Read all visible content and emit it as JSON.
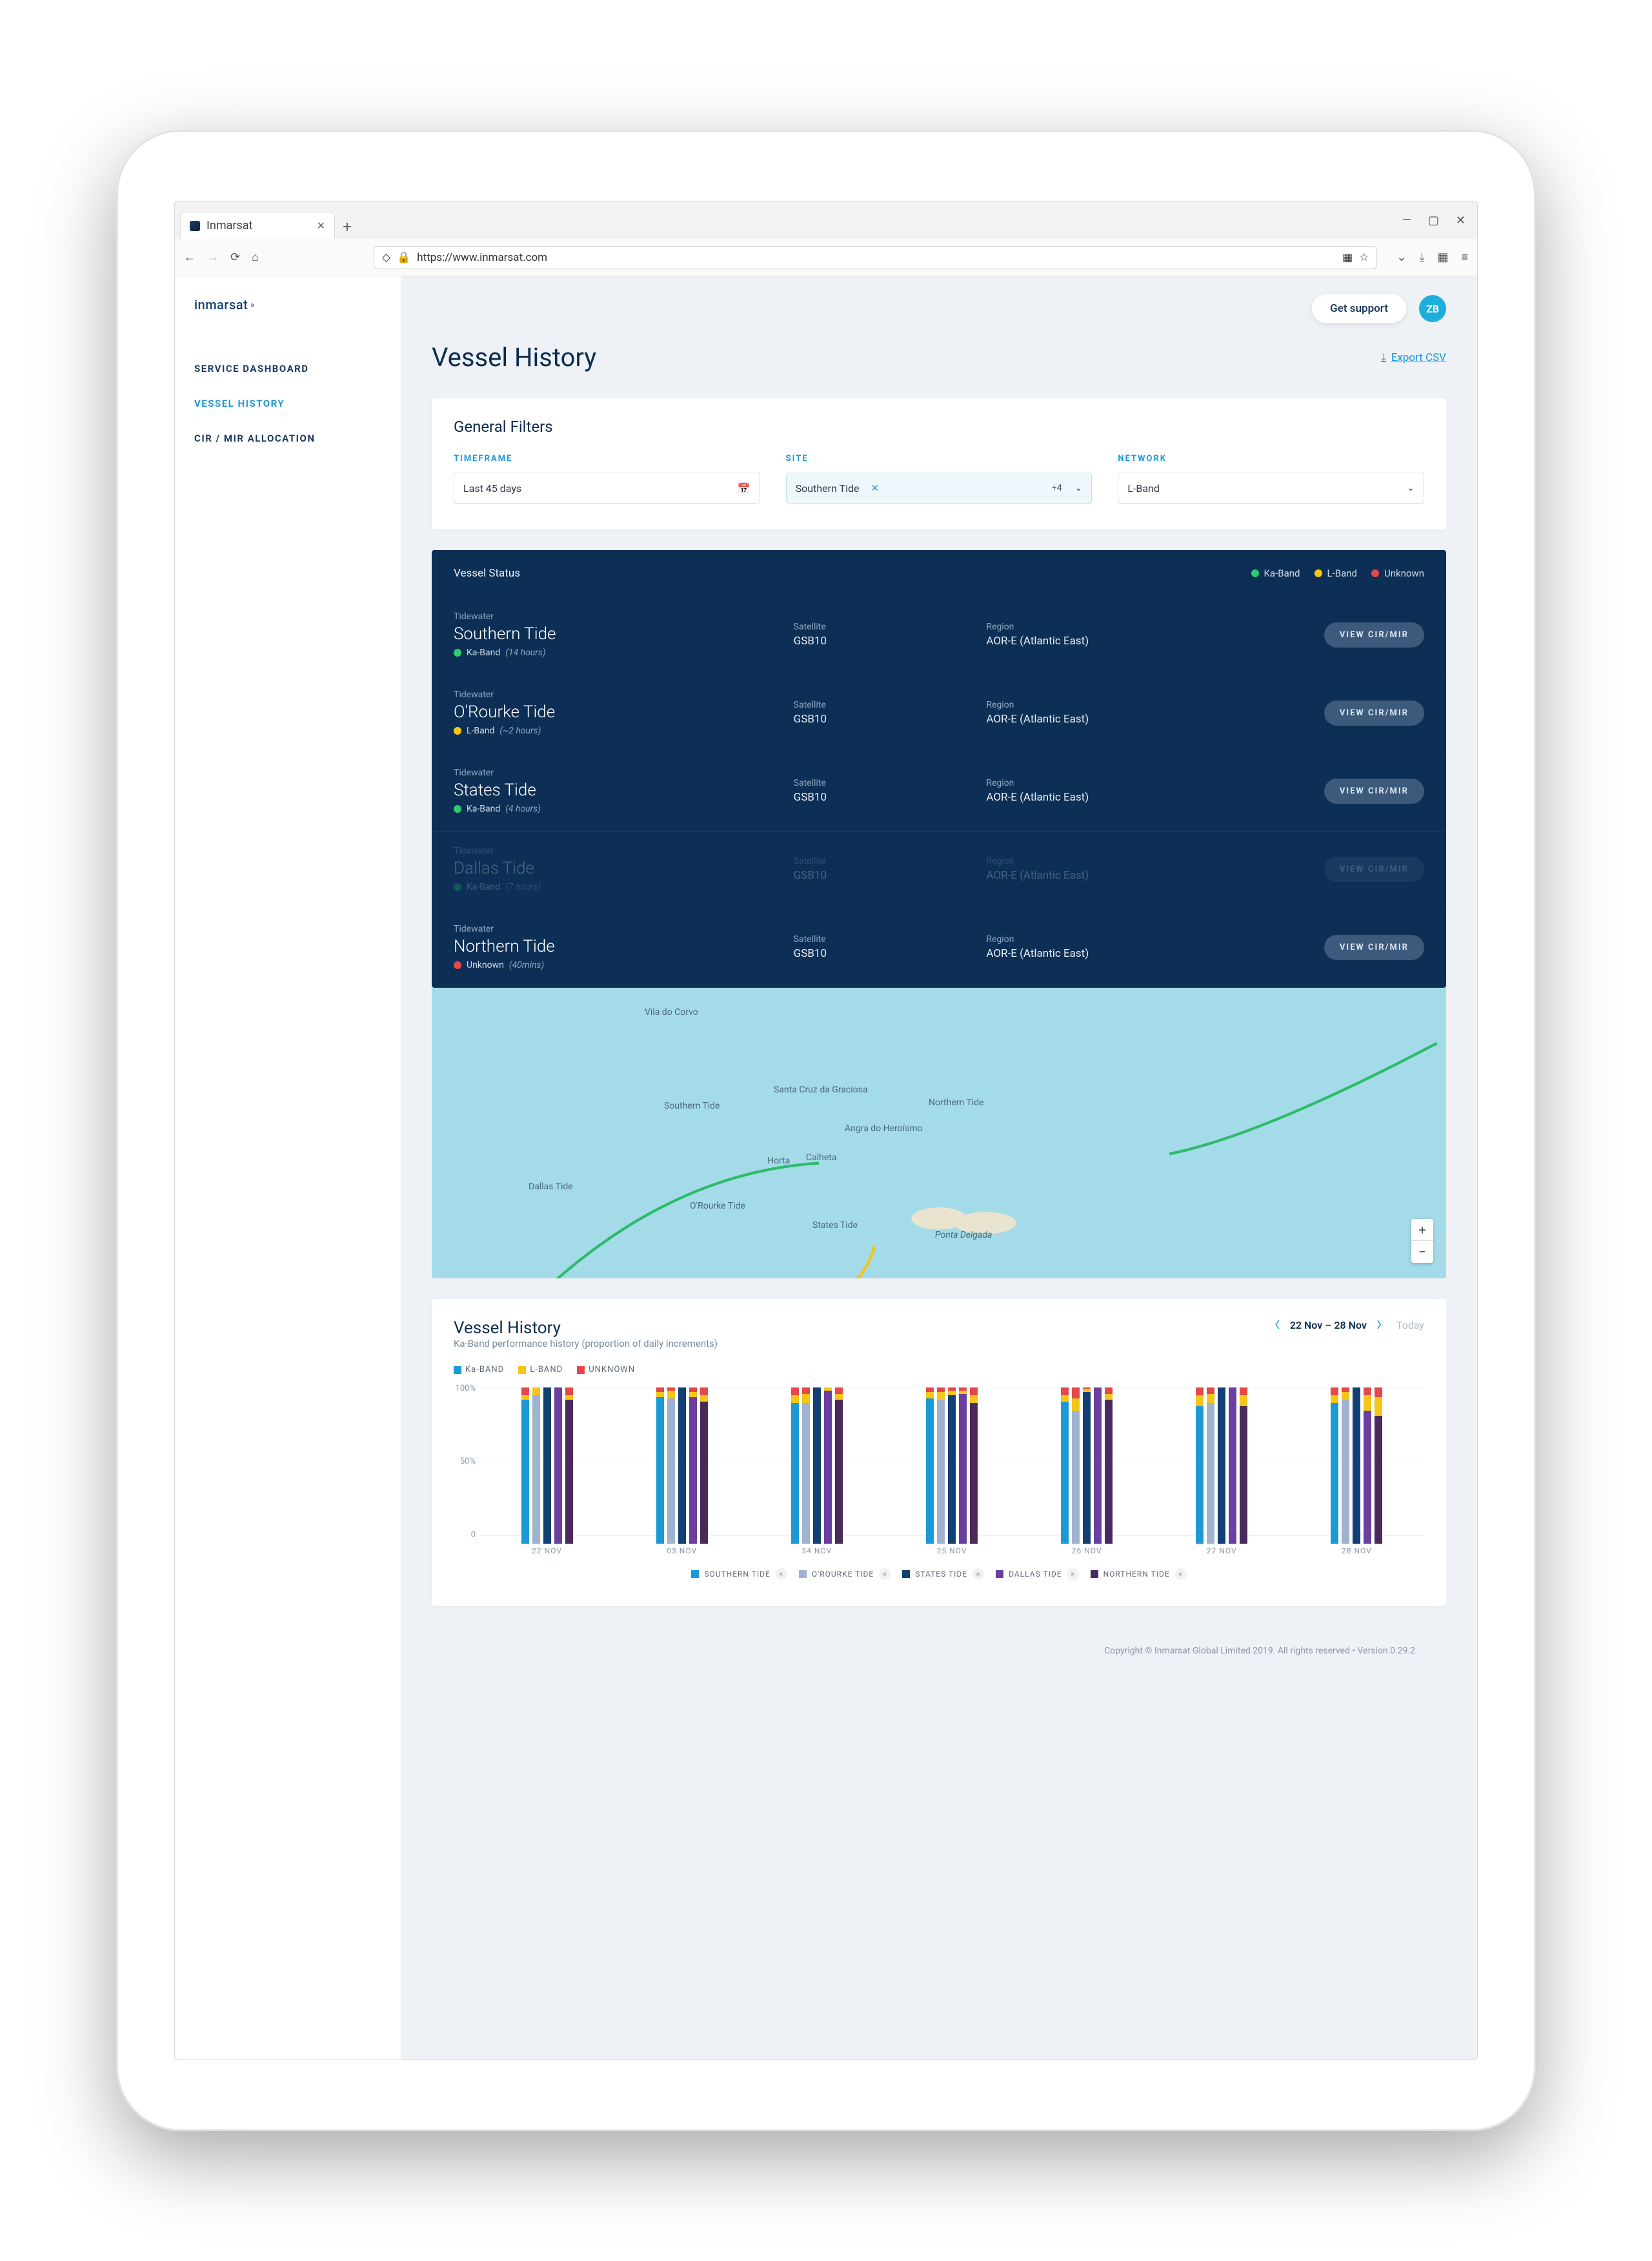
{
  "browser": {
    "tab_title": "Inmarsat",
    "url": "https://www.inmarsat.com"
  },
  "brand": "inmarsat",
  "header": {
    "support": "Get support",
    "avatar": "ZB"
  },
  "nav": {
    "dashboard": "SERVICE DASHBOARD",
    "history": "VESSEL HISTORY",
    "allocation": "CIR / MIR ALLOCATION"
  },
  "page": {
    "title": "Vessel History",
    "export": "Export CSV"
  },
  "filters": {
    "heading": "General Filters",
    "timeframe_label": "TIMEFRAME",
    "timeframe_value": "Last 45 days",
    "site_label": "SITE",
    "site_value": "Southern Tide",
    "site_count": "+4",
    "network_label": "NETWORK",
    "network_value": "L-Band"
  },
  "status": {
    "title": "Vessel Status",
    "legend": {
      "ka": "Ka-Band",
      "l": "L-Band",
      "un": "Unknown"
    },
    "cols": {
      "satellite": "Satellite",
      "region": "Region"
    },
    "button": "VIEW CIR/MIR",
    "vessels": [
      {
        "group": "Tidewater",
        "name": "Southern Tide",
        "band": "Ka-Band",
        "dot": "green",
        "time": "(14 hours)",
        "satellite": "GSB10",
        "region": "AOR-E (Atlantic East)",
        "faded": false
      },
      {
        "group": "Tidewater",
        "name": "O'Rourke Tide",
        "band": "L-Band",
        "dot": "yellow",
        "time": "(~2 hours)",
        "satellite": "GSB10",
        "region": "AOR-E (Atlantic East)",
        "faded": false
      },
      {
        "group": "Tidewater",
        "name": "States Tide",
        "band": "Ka-Band",
        "dot": "green",
        "time": "(4 hours)",
        "satellite": "GSB10",
        "region": "AOR-E (Atlantic East)",
        "faded": false
      },
      {
        "group": "Tidewater",
        "name": "Dallas Tide",
        "band": "Ka-Band",
        "dot": "green",
        "time": "(7 hours)",
        "satellite": "GSB10",
        "region": "AOR-E (Atlantic East)",
        "faded": true
      },
      {
        "group": "Tidewater",
        "name": "Northern Tide",
        "band": "Unknown",
        "dot": "red",
        "time": "(40mins)",
        "satellite": "GSB10",
        "region": "AOR-E (Atlantic East)",
        "faded": false
      }
    ]
  },
  "map": {
    "labels": {
      "vila": "Vila do Corvo",
      "santa": "Santa Cruz da Graciosa",
      "horta": "Horta",
      "calheta": "Calheta",
      "angra": "Angra do Heroísmo",
      "ponta": "Ponta Delgada"
    },
    "tracks": {
      "southern": "Southern Tide",
      "dallas": "Dallas Tide",
      "orourke": "O'Rourke Tide",
      "states": "States Tide",
      "northern": "Northern Tide"
    }
  },
  "chart": {
    "title": "Vessel History",
    "subtitle": "Ka-Band performance history (proportion of daily increments)",
    "range": "22 Nov – 28 Nov",
    "today": "Today",
    "legend": {
      "ka": "Ka-BAND",
      "l": "L-BAND",
      "un": "UNKNOWN"
    },
    "series_names": [
      "SOUTHERN TIDE",
      "O'ROURKE TIDE",
      "STATES TIDE",
      "DALLAS TIDE",
      "NORTHERN TIDE"
    ],
    "series_colors": [
      "#1c9ad6",
      "#9fb3d0",
      "#134074",
      "#6b3fa0",
      "#4a2a5a"
    ],
    "yticks": [
      "100%",
      "50%",
      "0"
    ],
    "categories": [
      "22 NOV",
      "03 NOV",
      "34 NOV",
      "25 NOV",
      "26 NOV",
      "27 NOV",
      "28 NOV"
    ]
  },
  "chart_data": {
    "type": "bar",
    "stacked": true,
    "ylim": [
      0,
      100
    ],
    "ylabel": "%",
    "categories": [
      "22 NOV",
      "03 NOV",
      "34 NOV",
      "25 NOV",
      "26 NOV",
      "27 NOV",
      "28 NOV"
    ],
    "series": [
      {
        "name": "SOUTHERN TIDE",
        "color": "#1c9ad6",
        "values": [
          {
            "ka": 92,
            "l": 3,
            "un": 5
          },
          {
            "ka": 94,
            "l": 3,
            "un": 3
          },
          {
            "ka": 90,
            "l": 5,
            "un": 5
          },
          {
            "ka": 93,
            "l": 4,
            "un": 3
          },
          {
            "ka": 91,
            "l": 4,
            "un": 5
          },
          {
            "ka": 88,
            "l": 7,
            "un": 5
          },
          {
            "ka": 90,
            "l": 5,
            "un": 5
          }
        ]
      },
      {
        "name": "O'ROURKE TIDE",
        "color": "#9fb3d0",
        "values": [
          {
            "ka": 95,
            "l": 5,
            "un": 0
          },
          {
            "ka": 93,
            "l": 5,
            "un": 2
          },
          {
            "ka": 90,
            "l": 6,
            "un": 4
          },
          {
            "ka": 92,
            "l": 5,
            "un": 3
          },
          {
            "ka": 85,
            "l": 8,
            "un": 7
          },
          {
            "ka": 90,
            "l": 6,
            "un": 4
          },
          {
            "ka": 92,
            "l": 5,
            "un": 3
          }
        ]
      },
      {
        "name": "STATES TIDE",
        "color": "#134074",
        "values": [
          {
            "ka": 100,
            "l": 0,
            "un": 0
          },
          {
            "ka": 100,
            "l": 0,
            "un": 0
          },
          {
            "ka": 100,
            "l": 0,
            "un": 0
          },
          {
            "ka": 95,
            "l": 3,
            "un": 2
          },
          {
            "ka": 97,
            "l": 2,
            "un": 1
          },
          {
            "ka": 100,
            "l": 0,
            "un": 0
          },
          {
            "ka": 100,
            "l": 0,
            "un": 0
          }
        ]
      },
      {
        "name": "DALLAS TIDE",
        "color": "#6b3fa0",
        "values": [
          {
            "ka": 100,
            "l": 0,
            "un": 0
          },
          {
            "ka": 94,
            "l": 3,
            "un": 3
          },
          {
            "ka": 98,
            "l": 2,
            "un": 0
          },
          {
            "ka": 96,
            "l": 2,
            "un": 2
          },
          {
            "ka": 100,
            "l": 0,
            "un": 0
          },
          {
            "ka": 100,
            "l": 0,
            "un": 0
          },
          {
            "ka": 85,
            "l": 10,
            "un": 5
          }
        ]
      },
      {
        "name": "NORTHERN TIDE",
        "color": "#4a2a5a",
        "values": [
          {
            "ka": 92,
            "l": 3,
            "un": 5
          },
          {
            "ka": 91,
            "l": 4,
            "un": 5
          },
          {
            "ka": 92,
            "l": 4,
            "un": 4
          },
          {
            "ka": 90,
            "l": 5,
            "un": 5
          },
          {
            "ka": 92,
            "l": 4,
            "un": 4
          },
          {
            "ka": 88,
            "l": 7,
            "un": 5
          },
          {
            "ka": 82,
            "l": 12,
            "un": 6
          }
        ]
      }
    ]
  },
  "footer": "Copyright © Inmarsat Global Limited 2019. All rights reserved • Version 0.29.2"
}
